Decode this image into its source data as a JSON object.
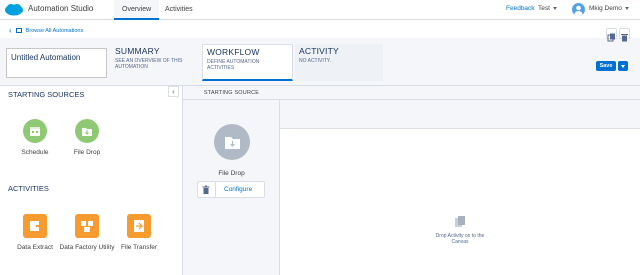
{
  "topnav": {
    "app_name": "Automation Studio",
    "tabs": [
      {
        "label": "Overview",
        "active": true
      },
      {
        "label": "Activities",
        "active": false
      }
    ],
    "feedback": "Feedback",
    "business_unit": "Test",
    "user": "Mkig Demo"
  },
  "breadcrumb": {
    "label": "Browse All Automations"
  },
  "automation": {
    "name": "Untitled Automation"
  },
  "steps": [
    {
      "title": "SUMMARY",
      "desc": "SEE AN OVERVIEW OF THIS AUTOMATION"
    },
    {
      "title": "WORKFLOW",
      "desc": "DEFINE AUTOMATION ACTIVITIES"
    },
    {
      "title": "ACTIVITY",
      "desc": "NO ACTIVITY."
    }
  ],
  "toolbar": {
    "save_label": "Save"
  },
  "sidebar": {
    "starting_sources_title": "STARTING SOURCES",
    "starting_sources": [
      {
        "label": "Schedule"
      },
      {
        "label": "File Drop"
      }
    ],
    "activities_title": "ACTIVITIES",
    "activities": [
      {
        "label": "Data Extract"
      },
      {
        "label": "Data Factory Utility"
      },
      {
        "label": "File Transfer"
      }
    ]
  },
  "canvas": {
    "starting_source_header": "STARTING SOURCE",
    "source_label": "File Drop",
    "configure_label": "Configure",
    "drop_hint": "Drop Activity on to the Canvas"
  },
  "colors": {
    "accent": "#0070d2",
    "green": "#8fc973",
    "orange": "#f59b2f",
    "gray_icon": "#b0b9c6"
  }
}
